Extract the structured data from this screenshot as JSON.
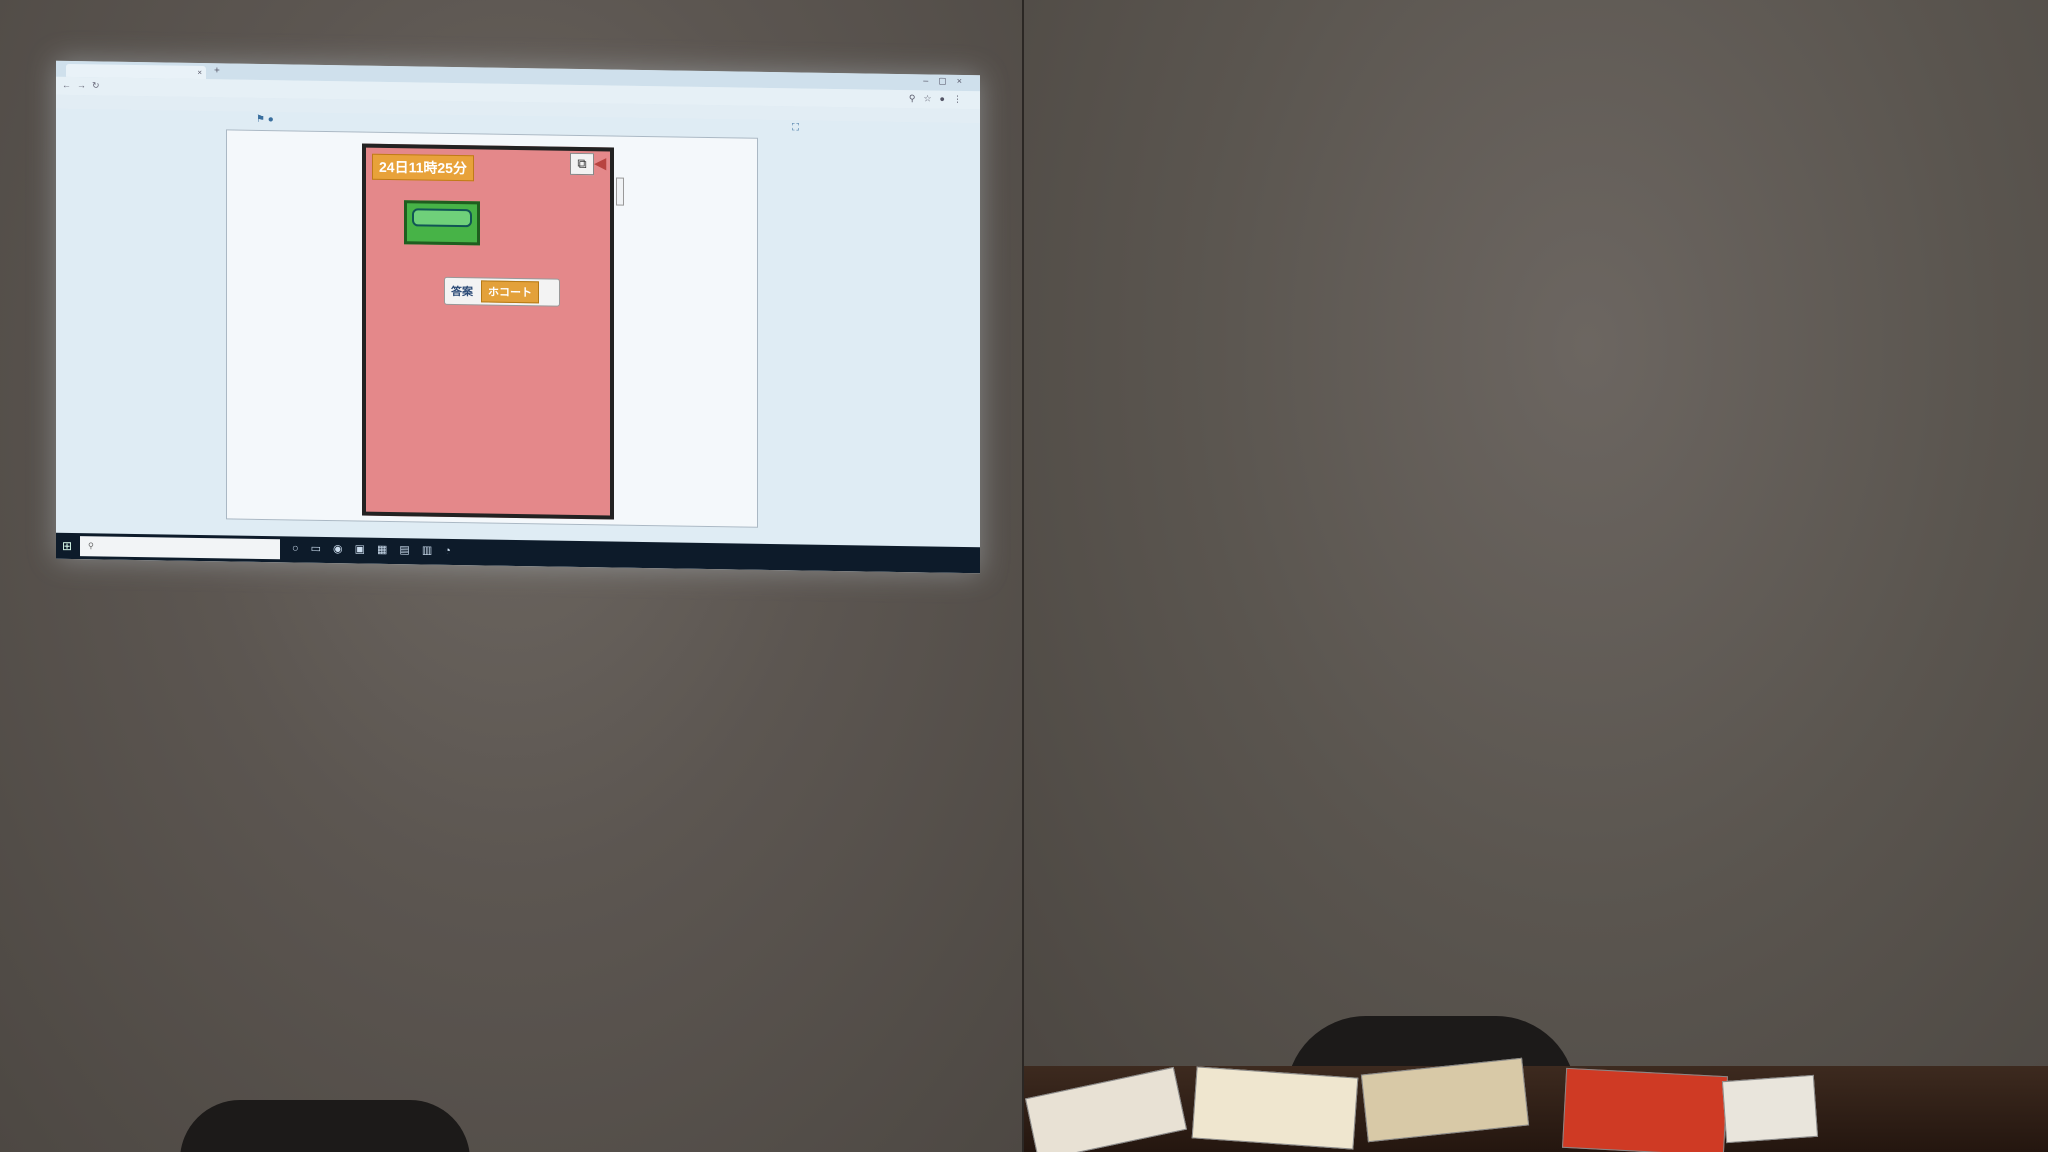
{
  "left_view": {
    "browser": {
      "tab_title": "",
      "url": "",
      "bookmarks": [
        "",
        "",
        "",
        "",
        "",
        ""
      ]
    },
    "app": {
      "date_label": "24日11時25分",
      "answer_label": "答案",
      "answer_value": "ホコート"
    },
    "taskbar": {
      "search_placeholder": "",
      "tray_text": ""
    }
  },
  "right_view": {
    "browser": {
      "tab_title": "",
      "url": ""
    },
    "taskbar": {
      "search_placeholder": "",
      "tray_text": ""
    }
  },
  "icons": [
    "window-icon",
    "speaker-icon",
    "back-icon",
    "forward-icon",
    "reload-icon",
    "new-tab-icon",
    "close-tab-icon",
    "windows-start-icon",
    "search-icon"
  ],
  "colors": {
    "stage_bg": "#e4888a",
    "date_label_bg": "#e8a23a",
    "green_button": "#47b347",
    "taskbar": "#0d1b2a",
    "wall": "#5a5550"
  }
}
